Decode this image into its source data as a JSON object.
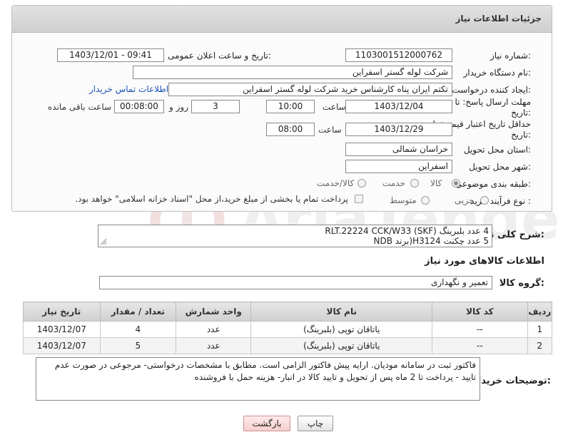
{
  "header": {
    "title": "جزئیات اطلاعات نیاز"
  },
  "form": {
    "need_number": {
      "label": "شماره نیاز:",
      "value": "1103001512000762"
    },
    "announce_datetime": {
      "label": "تاریخ و ساعت اعلان عمومی:",
      "value": "1403/12/01 - 09:41"
    },
    "buyer_org": {
      "label": "نام دستگاه خریدار:",
      "value": "شرکت لوله گستر اسفراین"
    },
    "requester": {
      "label": "ایجاد کننده درخواست:",
      "value": "تکتم ایران پناه کارشناس خرید شرکت لوله گستر اسفراین",
      "contact_link": "اطلاعات تماس خریدار"
    },
    "reply_deadline": {
      "label_line1": "مهلت ارسال پاسخ: تا",
      "label_line2": "تاریخ:",
      "date": "1403/12/04",
      "time_label": "ساعت",
      "time": "10:00",
      "days": "3",
      "days_label": "روز و",
      "remaining": "00:08:00",
      "remaining_label": "ساعت باقی مانده"
    },
    "price_validity": {
      "label_line1": "حداقل تاریخ اعتبار قیمت: تا",
      "label_line2": "تاریخ:",
      "date": "1403/12/29",
      "time_label": "ساعت",
      "time": "08:00"
    },
    "province": {
      "label": "استان محل تحویل:",
      "value": "خراسان شمالی"
    },
    "city": {
      "label": "شهر محل تحویل:",
      "value": "اسفراین"
    },
    "category": {
      "label": "طبقه بندی موضوعی:",
      "options": [
        {
          "label": "کالا",
          "selected": true
        },
        {
          "label": "خدمت",
          "selected": false
        },
        {
          "label": "کالا/خدمت",
          "selected": false
        }
      ]
    },
    "purchase_type": {
      "label": "نوع فرآیند خرید :",
      "options": [
        {
          "label": "جزیی",
          "selected": false
        },
        {
          "label": "متوسط",
          "selected": false
        }
      ],
      "treasury_note": "پرداخت تمام یا بخشی از مبلغ خرید،از محل \"اسناد خزانه اسلامی\" خواهد بود."
    }
  },
  "description": {
    "label": "شرح کلی نیاز:",
    "lines": [
      "4 عدد بلبرینگ RLT.22224 CCK/W33 (SKF)",
      "5 عدد چکنت H3124(برند NDB"
    ]
  },
  "goods_info": {
    "title": "اطلاعات کالاهای مورد نیاز",
    "group_label": "گروه کالا:",
    "group_value": "تعمیر و نگهداری"
  },
  "table": {
    "headers": [
      "ردیف",
      "کد کالا",
      "نام کالا",
      "واحد شمارش",
      "تعداد / مقدار",
      "تاریخ نیاز"
    ],
    "rows": [
      [
        "1",
        "--",
        "یاتاقان توپی (بلبرینگ)",
        "عدد",
        "4",
        "1403/12/07"
      ],
      [
        "2",
        "--",
        "یاتاقان توپی (بلبرینگ)",
        "عدد",
        "5",
        "1403/12/07"
      ]
    ]
  },
  "buyer_notes": {
    "label": "توضیحات خریدار:",
    "text": "فاکتور ثبت در سامانه مودیان. ارایه پیش فاکتور الزامی است. مطابق با مشخصات درخواستی- مرجوعی در صورت عدم تایید - پرداخت تا 2 ماه پس از تحویل و تایید کالا در انبار- هزینه حمل با فروشنده"
  },
  "buttons": {
    "print": "چاپ",
    "back": "بازگشت"
  },
  "colors": {
    "link": "#1f54b8",
    "header_bg": "#d6d6d6",
    "back_button": "#f7cfcf"
  }
}
